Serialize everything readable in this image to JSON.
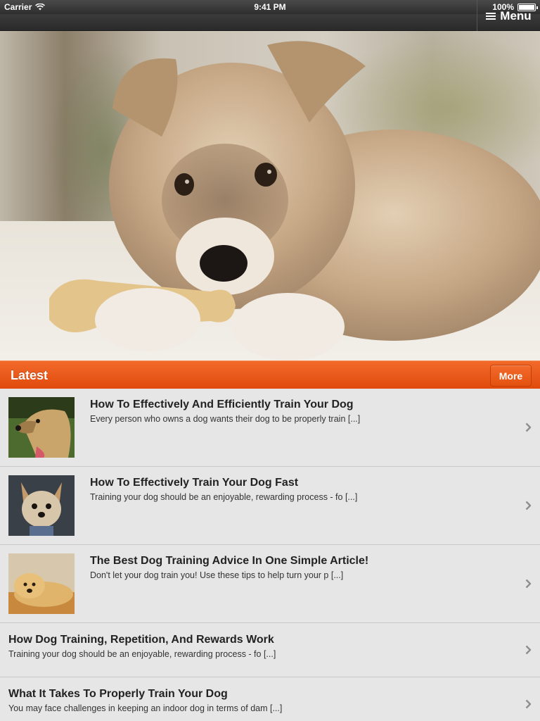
{
  "status_bar": {
    "carrier": "Carrier",
    "time": "9:41 PM",
    "battery": "100%"
  },
  "nav": {
    "menu_label": "Menu"
  },
  "hero": {
    "image": "puppy-chewing-bone-photo"
  },
  "section": {
    "title": "Latest",
    "more_label": "More"
  },
  "colors": {
    "accent": "#e85a1a",
    "navbar": "#2e2e2e",
    "list_bg": "#e6e6e6"
  },
  "articles": [
    {
      "title": "How To Effectively And Efficiently Train Your Dog",
      "excerpt": "Every person who owns a dog wants their dog to be properly train [...]",
      "thumbnail": "yorkshire-terrier-profile"
    },
    {
      "title": "How To Effectively Train Your Dog Fast",
      "excerpt": "Training your dog should be an enjoyable, rewarding process - fo [...]",
      "thumbnail": "yorkie-portrait"
    },
    {
      "title": "The Best Dog Training Advice In One Simple Article!",
      "excerpt": "Don't let your dog train you! Use these tips to help turn your p [...]",
      "thumbnail": "golden-retriever-lying"
    },
    {
      "title": "How Dog Training, Repetition, And Rewards Work",
      "excerpt": "Training your dog should be an enjoyable, rewarding process - fo [...]"
    },
    {
      "title": "What It Takes To Properly Train Your Dog",
      "excerpt": "You may face challenges in keeping an indoor dog in terms of dam [...]"
    }
  ]
}
